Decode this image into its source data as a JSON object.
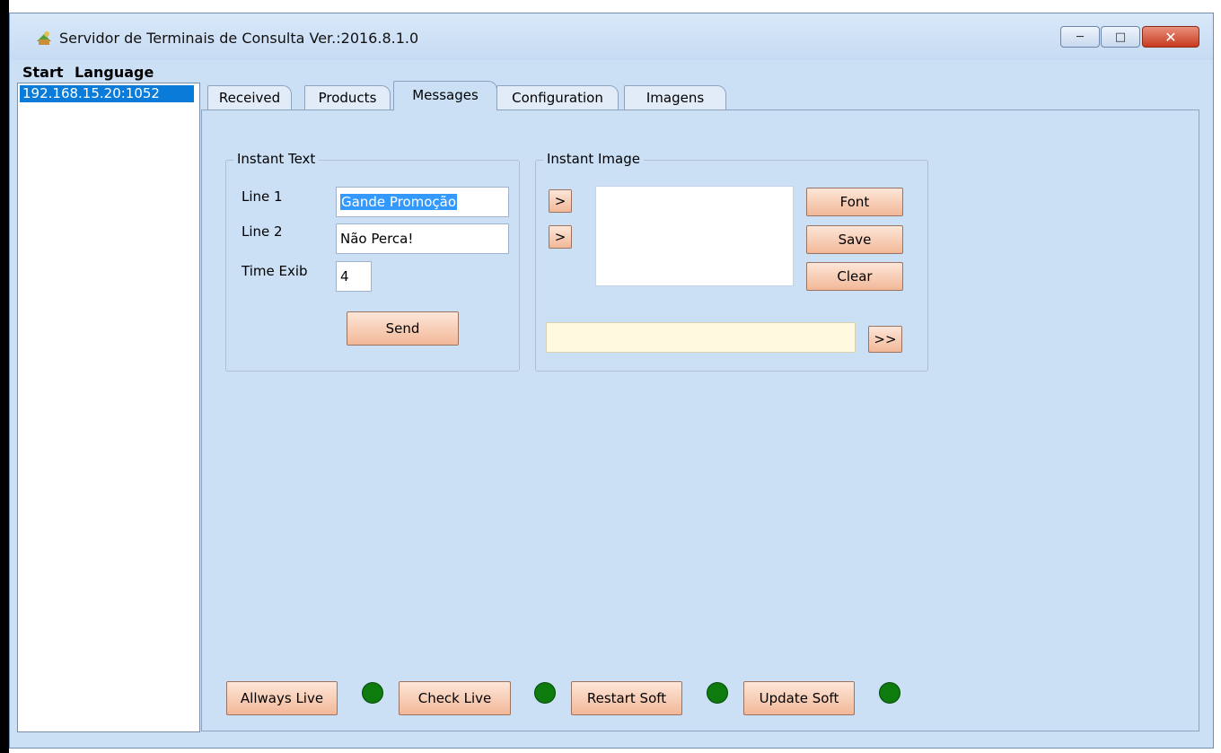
{
  "window": {
    "title": "Servidor de Terminais de Consulta Ver.:2016.8.1.0",
    "icon": "app-icon",
    "controls": {
      "minimize": "─",
      "maximize": "□",
      "close": "✕"
    }
  },
  "menu": {
    "items": [
      "Start",
      "Language"
    ]
  },
  "sidebar": {
    "connections": [
      "192.168.15.20:1052"
    ]
  },
  "tabs": [
    "Received",
    "Products",
    "Messages",
    "Configuration",
    "Imagens"
  ],
  "active_tab": "Messages",
  "instant_text": {
    "legend": "Instant Text",
    "line1_label": "Line 1",
    "line1_value": "Gande Promoção",
    "line2_label": "Line 2",
    "line2_value": "Não Perca!",
    "time_label": "Time Exib",
    "time_value": "4",
    "send_label": "Send"
  },
  "instant_image": {
    "legend": "Instant Image",
    "arrow1_label": ">",
    "arrow2_label": ">",
    "font_label": "Font",
    "save_label": "Save",
    "clear_label": "Clear",
    "path_value": "",
    "browse_label": ">>"
  },
  "bottom_bar": {
    "always_live_label": "Allways Live",
    "check_live_label": "Check Live",
    "restart_label": "Restart Soft",
    "update_label": "Update Soft",
    "status_color": "#0d7b0d"
  }
}
